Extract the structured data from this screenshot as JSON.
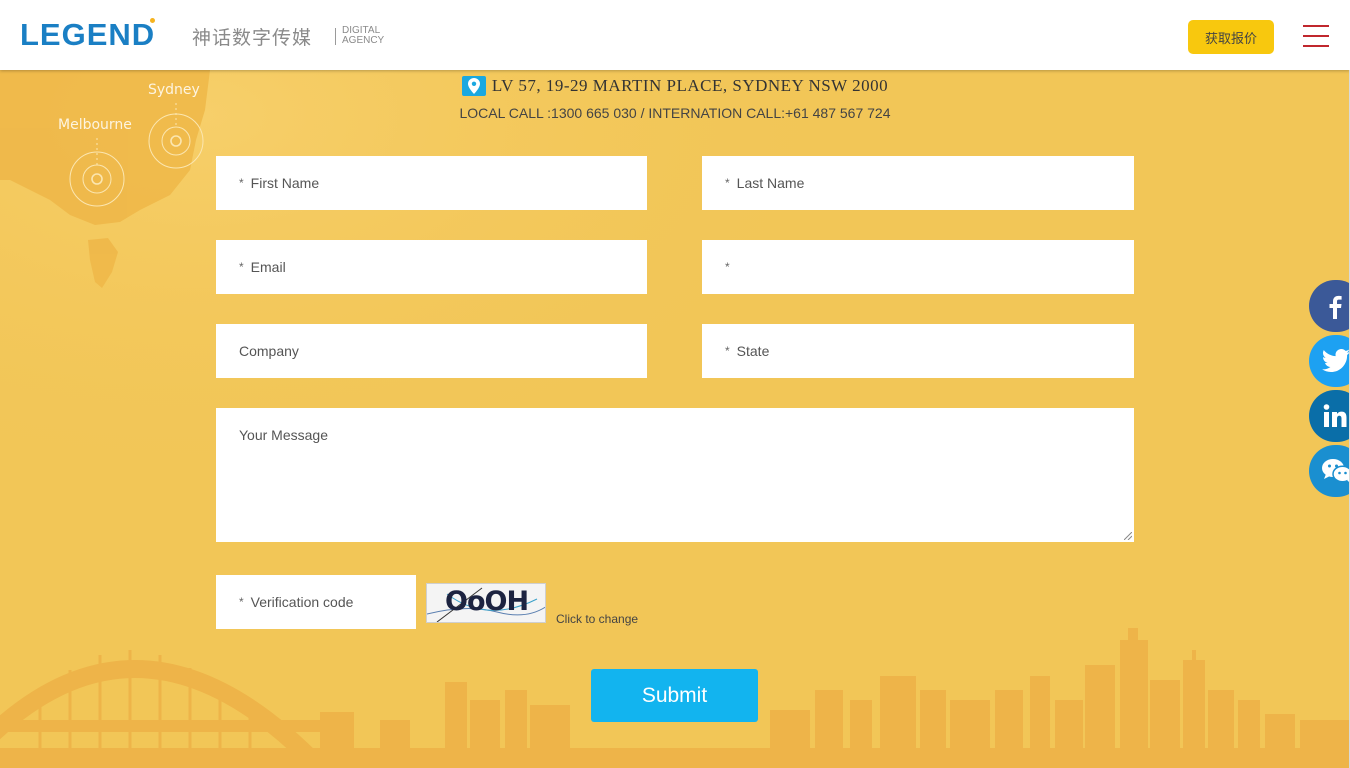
{
  "header": {
    "logo_text": "LEGEND",
    "logo_cn": "神话数字传媒",
    "logo_digital": "DIGITAL",
    "logo_agency": "AGENCY",
    "quote_label": "获取报价",
    "menu_icon": "hamburger-icon"
  },
  "map": {
    "city_1": "Sydney",
    "city_2": "Melbourne"
  },
  "contact": {
    "address": "LV 57, 19-29 MARTIN PLACE, SYDNEY NSW 2000",
    "calls": "LOCAL CALL :1300 665 030 / INTERNATION CALL:+61 487 567 724",
    "pin_icon": "location-pin-icon"
  },
  "form": {
    "required_mark": "*",
    "first_name": "First Name",
    "last_name": "Last Name",
    "email": "Email",
    "phone": "",
    "company": "Company",
    "state": "State",
    "message": "Your Message",
    "verification": "Verification code",
    "captcha_text": "OoOH",
    "captcha_change": "Click to change",
    "submit": "Submit"
  },
  "social": [
    {
      "name": "facebook-icon",
      "color": "#3b5998"
    },
    {
      "name": "twitter-icon",
      "color": "#1da1f2"
    },
    {
      "name": "linkedin-icon",
      "color": "#0077b5"
    },
    {
      "name": "wechat-icon",
      "color": "#1a8fd0"
    }
  ],
  "colors": {
    "background": "#f2c657",
    "accent_blue": "#12b4ef",
    "quote_yellow": "#f8c80e",
    "menu_red": "#c0272d"
  }
}
